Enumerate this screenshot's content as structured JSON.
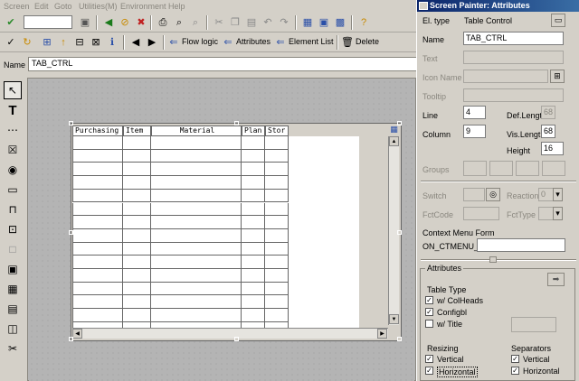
{
  "menu": [
    "Screen",
    "Edit",
    "Goto",
    "Utilities(M)",
    "Environment",
    "Help"
  ],
  "toolbar2": {
    "flow_logic": "Flow logic",
    "attributes": "Attributes",
    "element_list": "Element List",
    "delete": "Delete"
  },
  "namerow": {
    "label": "Name",
    "value": "TAB_CTRL"
  },
  "table_control": {
    "columns": [
      "Purchasing",
      "Item",
      "Material",
      "Plan",
      "Stor"
    ]
  },
  "dialog": {
    "title": "Screen Painter: Attributes",
    "el_type_label": "El. type",
    "el_type_value": "Table Control",
    "name_label": "Name",
    "name_value": "TAB_CTRL",
    "text_label": "Text",
    "icon_name_label": "Icon Name",
    "tooltip_label": "Tooltip",
    "line_label": "Line",
    "line_value": "4",
    "def_length_label": "Def.Lengt",
    "def_length_value": "68",
    "column_label": "Column",
    "column_value": "9",
    "vis_length_label": "Vis.Lengtl",
    "vis_length_value": "68",
    "height_label": "Height",
    "height_value": "16",
    "groups_label": "Groups",
    "switch_label": "Switch",
    "reaction_label": "Reaction",
    "reaction_value": "0",
    "fctcode_label": "FctCode",
    "fcttype_label": "FctType",
    "context_menu_label": "Context Menu Form",
    "context_menu_prefix": "ON_CTMENU_",
    "attributes_group": "Attributes",
    "table_type_label": "Table Type",
    "w_colheads": "w/ ColHeads",
    "configbl": "Configbl",
    "w_title": "w/ Title",
    "resizing_label": "Resizing",
    "resizing_vertical": "Vertical",
    "resizing_horizontal": "Horizontal",
    "separators_label": "Separators",
    "sep_vertical": "Vertical",
    "sep_horizontal": "Horizontal"
  }
}
